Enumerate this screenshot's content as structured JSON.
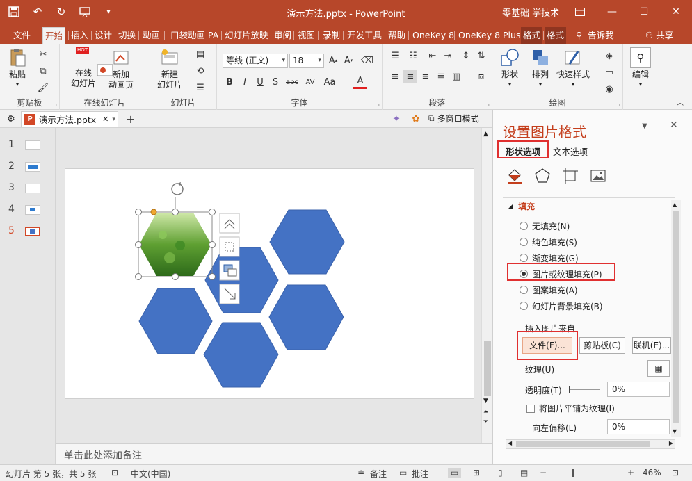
{
  "titlebar": {
    "title": "演示方法.pptx  -  PowerPoint",
    "user": "零基础 学技术",
    "qat": [
      "save-icon",
      "undo-icon",
      "redo-icon",
      "slideshow-icon",
      "customize-icon"
    ]
  },
  "tabs": [
    "文件",
    "开始",
    "插入",
    "设计",
    "切换",
    "动画",
    "口袋动画 PA",
    "幻灯片放映",
    "审阅",
    "视图",
    "录制",
    "开发工具",
    "帮助",
    "OneKey 8",
    "OneKey 8 Plus",
    "格式",
    "格式",
    "告诉我",
    "共享"
  ],
  "ribbon": {
    "clipboard": {
      "paste": "粘贴",
      "label": "剪贴板"
    },
    "online": {
      "online_slide": "在线\n幻灯片",
      "new_anim": "新加\n动画页",
      "hot": "HOT",
      "label": "在线幻灯片"
    },
    "slides": {
      "new_slide": "新建\n幻灯片",
      "label": "幻灯片"
    },
    "font": {
      "name": "等线 (正文)",
      "size": "18",
      "label": "字体"
    },
    "paragraph": {
      "label": "段落"
    },
    "drawing": {
      "shape": "形状",
      "arrange": "排列",
      "quick_style": "快速样式",
      "label": "绘图"
    },
    "editing": {
      "edit": "编辑"
    }
  },
  "document_tab": {
    "name": "演示方法.pptx",
    "multiwindow": "多窗口模式"
  },
  "thumbnails": [
    {
      "num": "1"
    },
    {
      "num": "2"
    },
    {
      "num": "3"
    },
    {
      "num": "4"
    },
    {
      "num": "5",
      "selected": true
    }
  ],
  "notes": "单击此处添加备注",
  "pane": {
    "title": "设置图片格式",
    "tab_shape": "形状选项",
    "tab_text": "文本选项",
    "section": "填充",
    "options": [
      {
        "label": "无填充(N)",
        "checked": false
      },
      {
        "label": "纯色填充(S)",
        "checked": false
      },
      {
        "label": "渐变填充(G)",
        "checked": false
      },
      {
        "label": "图片或纹理填充(P)",
        "checked": true
      },
      {
        "label": "图案填充(A)",
        "checked": false
      },
      {
        "label": "幻灯片背景填充(B)",
        "checked": false
      }
    ],
    "insert_from": "插入图片来自",
    "btn_file": "文件(F)...",
    "btn_clipboard": "剪贴板(C)",
    "btn_online": "联机(E)...",
    "texture": "纹理(U)",
    "transparency": "透明度(T)",
    "transparency_value": "0%",
    "tile": "将图片平铺为纹理(I)",
    "offset_left": "向左偏移(L)",
    "offset_value": "0%"
  },
  "status": {
    "slide_info": "幻灯片 第 5 张，共 5 张",
    "language": "中文(中国)",
    "notes": "备注",
    "comments": "批注",
    "zoom": "46%"
  },
  "colors": {
    "accent": "#b7472a",
    "hexagon": "#4472c4",
    "highlight_box": "#e03030"
  }
}
